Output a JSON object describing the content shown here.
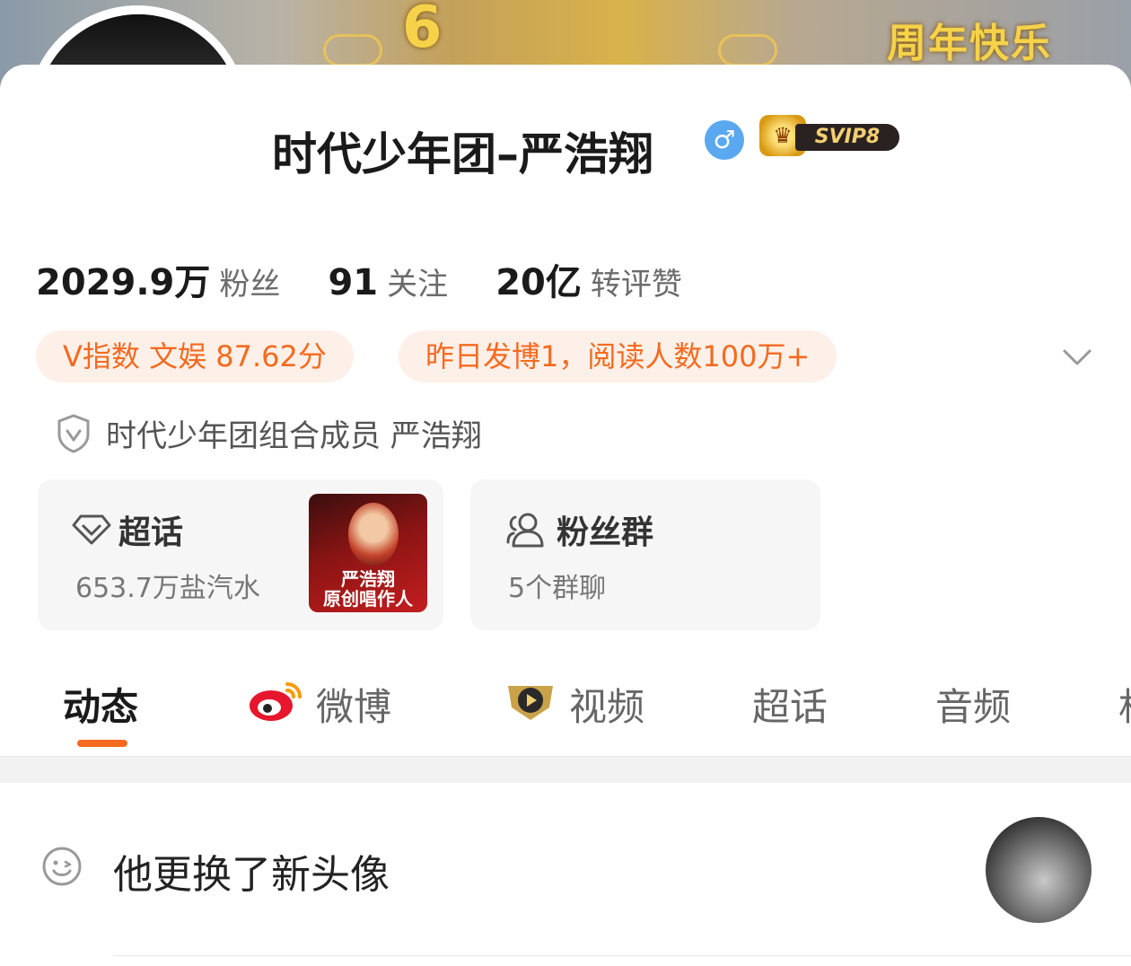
{
  "banner": {
    "big_number": "6",
    "text": "周年快乐"
  },
  "profile": {
    "name": "时代少年团–严浩翔",
    "gender_symbol": "♂",
    "svip_label": "SVIP8",
    "verified_badge": "V"
  },
  "stats": [
    {
      "value": "2029.9万",
      "label": "粉丝"
    },
    {
      "value": "91",
      "label": "关注"
    },
    {
      "value": "20亿",
      "label": "转评赞"
    }
  ],
  "pills": {
    "v_index": "V指数 文娱 87.62分",
    "post_info": "昨日发博1，阅读人数100万+"
  },
  "verification": {
    "text": "时代少年团组合成员 严浩翔"
  },
  "boxes": {
    "super_topic": {
      "title": "超话",
      "subtitle": "653.7万盐汽水",
      "thumb_text_line1": "严浩翔",
      "thumb_text_line2": "原创唱作人"
    },
    "fan_group": {
      "title": "粉丝群",
      "subtitle": "5个群聊"
    }
  },
  "tabs": [
    {
      "label": "动态",
      "active": true
    },
    {
      "label": "微博",
      "active": false
    },
    {
      "label": "视频",
      "active": false
    },
    {
      "label": "超话",
      "active": false
    },
    {
      "label": "音频",
      "active": false
    },
    {
      "label": "相",
      "active": false
    }
  ],
  "feed": {
    "item_text": "他更换了新头像"
  },
  "colors": {
    "accent": "#f66a1e",
    "pill_bg": "#fdf0e8",
    "gender_blue": "#5aa8f0"
  },
  "icons": {
    "chevron": "chevron-down-icon",
    "shield": "verified-shield-icon",
    "super_topic": "diamond-icon",
    "fan_group": "people-icon",
    "weibo": "weibo-logo-icon",
    "video": "video-play-icon",
    "smile": "smile-icon"
  }
}
